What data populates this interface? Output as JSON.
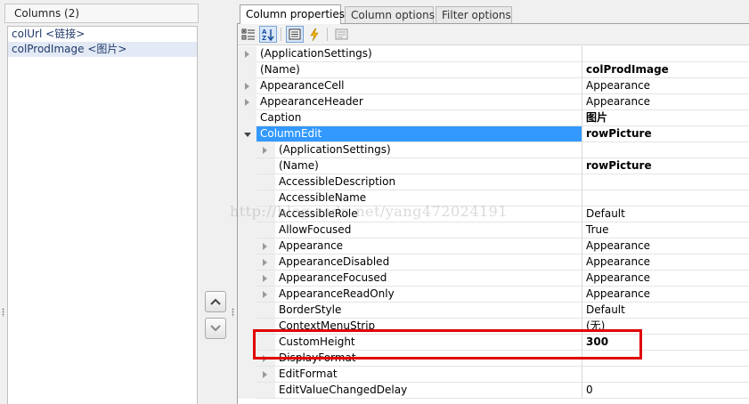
{
  "columns_panel": {
    "header": "Columns (2)",
    "items": [
      "colUrl <链接>",
      "colProdImage <图片>"
    ],
    "selected_index": 1
  },
  "tabs": [
    {
      "label": "Column properties",
      "active": true
    },
    {
      "label": "Column options",
      "active": false
    },
    {
      "label": "Filter options",
      "active": false
    }
  ],
  "toolbar": {
    "buttons": [
      "categorized-icon",
      "alphabetical-icon",
      "properties-icon",
      "events-icon",
      "property-pages-icon"
    ]
  },
  "properties": [
    {
      "name": "(ApplicationSettings)",
      "value": "",
      "expander": "collapsed",
      "level": 0
    },
    {
      "name": "(Name)",
      "value": "colProdImage",
      "bold": true,
      "level": 0
    },
    {
      "name": "AppearanceCell",
      "value": "Appearance",
      "expander": "collapsed",
      "level": 0
    },
    {
      "name": "AppearanceHeader",
      "value": "Appearance",
      "expander": "collapsed",
      "level": 0
    },
    {
      "name": "Caption",
      "value": "图片",
      "bold": true,
      "level": 0
    },
    {
      "name": "ColumnEdit",
      "value": "rowPicture",
      "bold": true,
      "expander": "expanded",
      "level": 0,
      "selected": true
    },
    {
      "name": "(ApplicationSettings)",
      "value": "",
      "expander": "collapsed",
      "level": 1
    },
    {
      "name": "(Name)",
      "value": "rowPicture",
      "bold": true,
      "level": 1
    },
    {
      "name": "AccessibleDescription",
      "value": "",
      "level": 1
    },
    {
      "name": "AccessibleName",
      "value": "",
      "level": 1
    },
    {
      "name": "AccessibleRole",
      "value": "Default",
      "level": 1
    },
    {
      "name": "AllowFocused",
      "value": "True",
      "level": 1
    },
    {
      "name": "Appearance",
      "value": "Appearance",
      "expander": "collapsed",
      "level": 1
    },
    {
      "name": "AppearanceDisabled",
      "value": "Appearance",
      "expander": "collapsed",
      "level": 1
    },
    {
      "name": "AppearanceFocused",
      "value": "Appearance",
      "expander": "collapsed",
      "level": 1
    },
    {
      "name": "AppearanceReadOnly",
      "value": "Appearance",
      "expander": "collapsed",
      "level": 1
    },
    {
      "name": "BorderStyle",
      "value": "Default",
      "level": 1
    },
    {
      "name": "ContextMenuStrip",
      "value": "(无)",
      "level": 1
    },
    {
      "name": "CustomHeight",
      "value": "300",
      "bold": true,
      "level": 1
    },
    {
      "name": "DisplayFormat",
      "value": "",
      "expander": "collapsed",
      "level": 1
    },
    {
      "name": "EditFormat",
      "value": "",
      "expander": "collapsed",
      "level": 1
    },
    {
      "name": "EditValueChangedDelay",
      "value": "0",
      "level": 1
    }
  ],
  "watermark": "http://blog.csdn.net/yang472024191",
  "colors": {
    "selection": "#3399ff",
    "highlight_box": "#e00000"
  }
}
